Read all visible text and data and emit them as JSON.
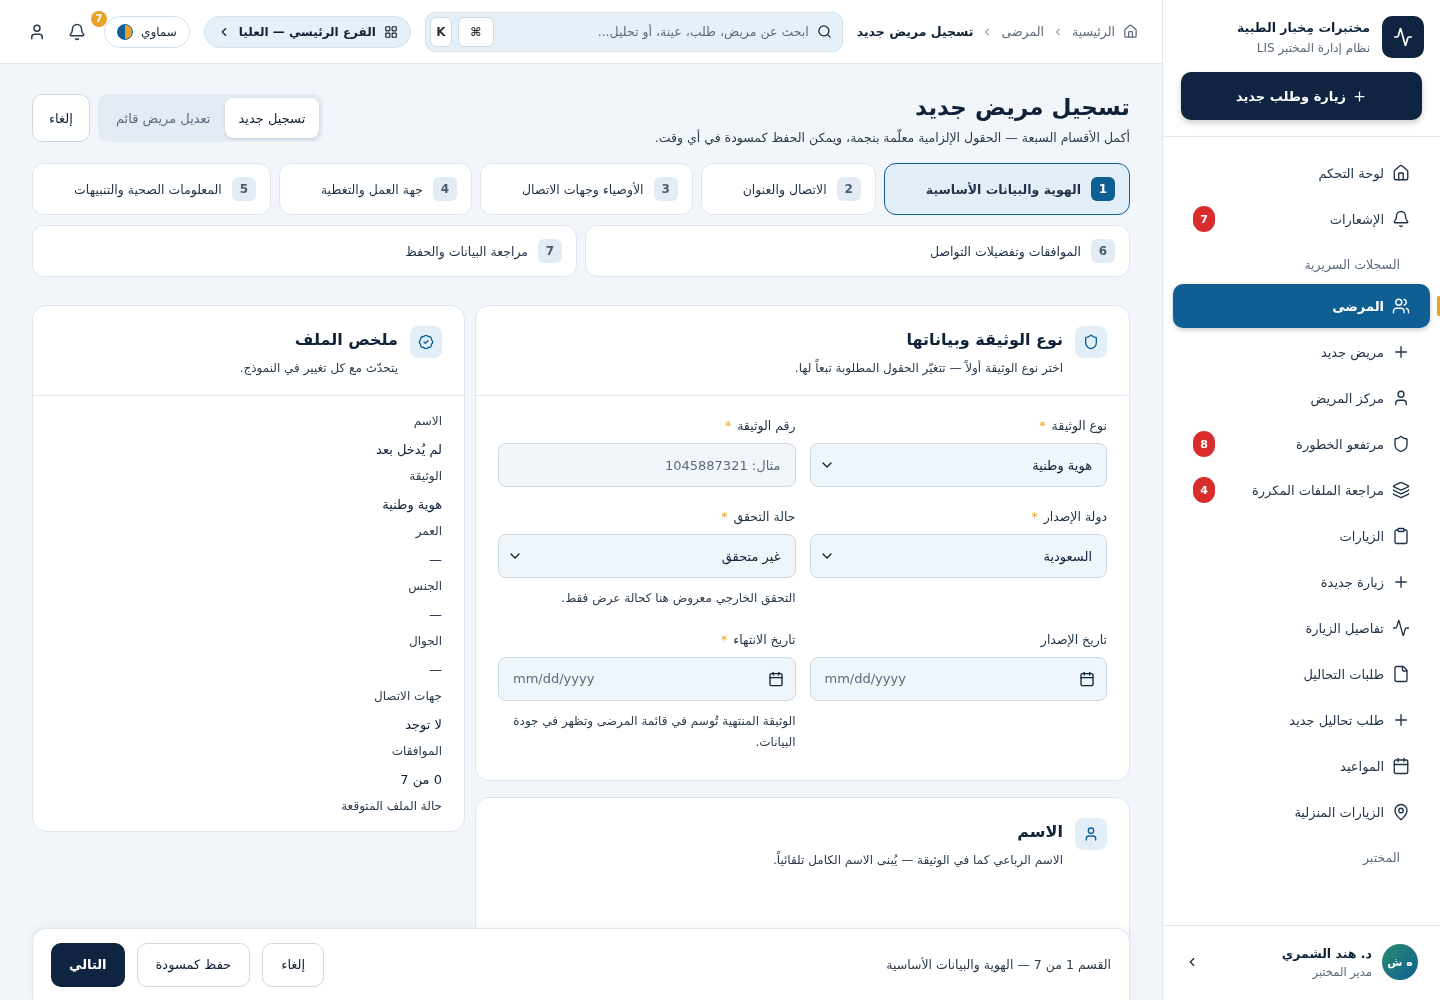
{
  "sidebar": {
    "brand": {
      "title": "مختبرات مِخبار الطبية",
      "subtitle": "نظام إدارة المختبر LIS"
    },
    "primary_action": "زيارة وطلب جديد",
    "sections": [
      {
        "items": [
          {
            "label": "لوحة التحكم",
            "selected": false
          },
          {
            "label": "الإشعارات",
            "badge": "7",
            "selected": false
          }
        ]
      },
      {
        "title": "السجلات السريرية",
        "items": [
          {
            "label": "المرضى",
            "selected": true
          },
          {
            "label": "مريض جديد",
            "selected": false
          },
          {
            "label": "مركز المريض",
            "selected": false
          },
          {
            "label": "مرتفعو الخطورة",
            "badge": "8",
            "selected": false
          },
          {
            "label": "مراجعة الملفات المكررة",
            "badge": "4",
            "selected": false
          },
          {
            "label": "الزيارات",
            "selected": false
          },
          {
            "label": "زيارة جديدة",
            "selected": false
          },
          {
            "label": "تفاصيل الزيارة",
            "selected": false
          },
          {
            "label": "طلبات التحاليل",
            "selected": false
          },
          {
            "label": "طلب تحاليل جديد",
            "selected": false
          },
          {
            "label": "المواعيد",
            "selected": false
          },
          {
            "label": "الزيارات المنزلية",
            "selected": false
          }
        ]
      },
      {
        "title": "المختبر"
      }
    ],
    "user": {
      "initials": "ه ش",
      "name": "د. هند الشمري",
      "role": "مدير المختبر"
    }
  },
  "header": {
    "breadcrumbs": [
      "الرئيسية",
      "المرضى",
      "تسجيل مريض جديد"
    ],
    "search": {
      "placeholder": "ابحث عن مريض، طلب، عينة، أو تحليل...",
      "keys": [
        "⌘",
        "K"
      ]
    },
    "branch": "الفرع الرئيسي — العليا",
    "theme": "سماوي",
    "notifications": "7"
  },
  "page": {
    "title": "تسجيل مريض جديد",
    "subtitle": "أكمل الأقسام السبعة — الحقول الإلزامية معلّمة بنجمة، ويمكن الحفظ كمسودة في أي وقت.",
    "modes": [
      {
        "label": "تسجيل جديد",
        "selected": true
      },
      {
        "label": "تعديل مريض قائم",
        "selected": false
      }
    ],
    "cancel": "إلغاء"
  },
  "steps": [
    {
      "number": "1",
      "label": "الهوية والبيانات الأساسية",
      "selected": true
    },
    {
      "number": "2",
      "label": "الاتصال والعنوان",
      "selected": false
    },
    {
      "number": "3",
      "label": "الأوصياء وجهات الاتصال",
      "selected": false
    },
    {
      "number": "4",
      "label": "جهة العمل والتغطية",
      "selected": false
    },
    {
      "number": "5",
      "label": "المعلومات الصحية والتنبيهات",
      "selected": false
    },
    {
      "number": "6",
      "label": "الموافقات وتفضيلات التواصل",
      "selected": false
    },
    {
      "number": "7",
      "label": "مراجعة البيانات والحفظ",
      "selected": false
    }
  ],
  "document_card": {
    "title": "نوع الوثيقة وبياناتها",
    "subtitle": "اختر نوع الوثيقة أولاً — تتغيّر الحقول المطلوبة تبعاً لها.",
    "fields": [
      {
        "label": "نوع الوثيقة",
        "required_mark": "*",
        "kind": "select",
        "value": "هوية وطنية"
      },
      {
        "label": "رقم الوثيقة",
        "required_mark": "*",
        "kind": "text",
        "placeholder": "مثال: 1045887321"
      },
      {
        "label": "دولة الإصدار",
        "required_mark": "*",
        "kind": "select",
        "value": "السعودية"
      },
      {
        "label": "حالة التحقق",
        "required_mark": "*",
        "kind": "select",
        "value": "غير متحقق",
        "hint": "التحقق الخارجي معروض هنا كحالة عرض فقط."
      },
      {
        "label": "تاريخ الإصدار",
        "kind": "date",
        "placeholder": "mm/dd/yyyy"
      },
      {
        "label": "تاريخ الانتهاء",
        "required_mark": "*",
        "kind": "date",
        "placeholder": "mm/dd/yyyy",
        "hint": "الوثيقة المنتهية تُوسم في قائمة المرضى وتظهر في جودة البيانات."
      }
    ]
  },
  "name_card": {
    "title": "الاسم",
    "subtitle": "الاسم الرباعي كما في الوثيقة — يُبنى الاسم الكامل تلقائياً."
  },
  "summary": {
    "title": "ملخص الملف",
    "subtitle": "يتحدّث مع كل تغيير في النموذج.",
    "rows": [
      {
        "label": "الاسم",
        "value": "لم يُدخل بعد"
      },
      {
        "label": "الوثيقة",
        "value": "هوية وطنية"
      },
      {
        "label": "العمر",
        "value": "—"
      },
      {
        "label": "الجنس",
        "value": "—"
      },
      {
        "label": "الجوال",
        "value": "—"
      },
      {
        "label": "جهات الاتصال",
        "value": "لا توجد"
      },
      {
        "label": "الموافقات",
        "value": "0 من 7"
      },
      {
        "label": "حالة الملف المتوقعة"
      }
    ]
  },
  "footer": {
    "progress": "القسم 1 من 7 — الهوية والبيانات الأساسية",
    "buttons": [
      {
        "label": "إلغاء",
        "kind": "secondary"
      },
      {
        "label": "حفظ كمسودة",
        "kind": "secondary"
      },
      {
        "label": "التالي",
        "kind": "primary"
      }
    ]
  }
}
